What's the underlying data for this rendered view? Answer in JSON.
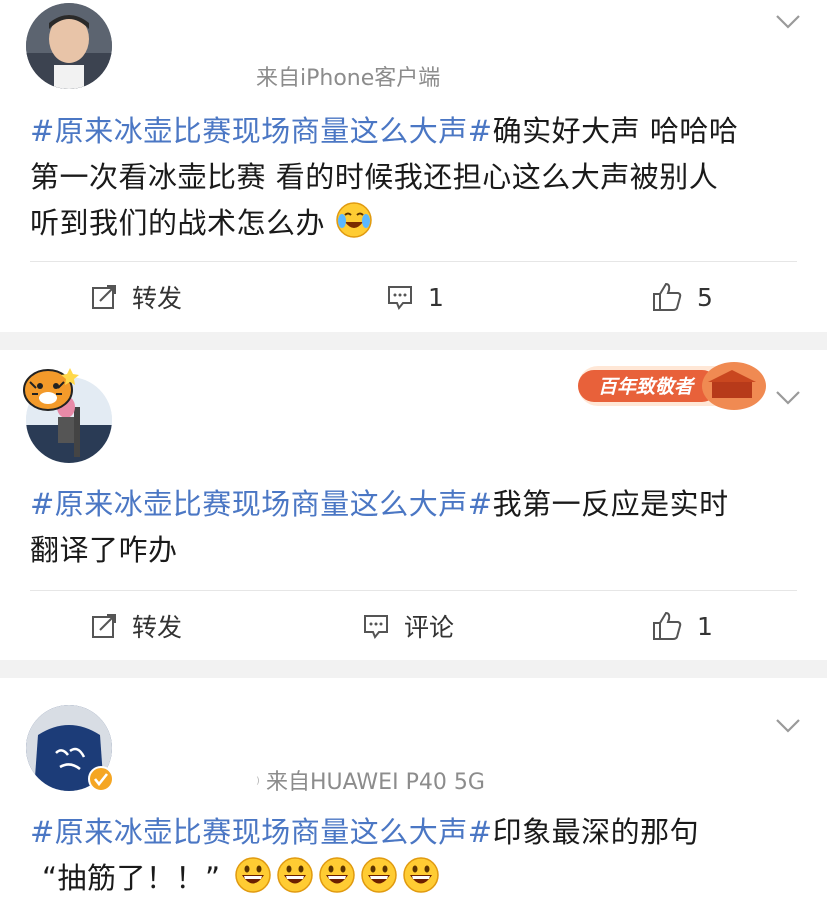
{
  "posts": [
    {
      "source": "来自iPhone客户端",
      "topic": "#原来冰壶比赛现场商量这么大声#",
      "text_line1": "确实好大声 哈哈哈",
      "text_line2": "第一次看冰壶比赛 看的时候我还担心这么大声被别人",
      "text_line3": "听到我们的战术怎么办",
      "emoji": "laugh-cry-emoji",
      "repost_label": "转发",
      "comment_count": "1",
      "like_count": "5"
    },
    {
      "badge_text": "百年致敬者",
      "topic": "#原来冰壶比赛现场商量这么大声#",
      "text_line1": "我第一反应是实时",
      "text_line2": "翻译了咋办",
      "repost_label": "转发",
      "comment_label": "评论",
      "like_count": "1"
    },
    {
      "source_mark": "⁾",
      "source": "来自HUAWEI P40 5G",
      "topic": "#原来冰壶比赛现场商量这么大声#",
      "text_line1": "印象最深的那句",
      "text_line2": "“抽筋了！！”",
      "emoji": "grin-emoji"
    }
  ],
  "colors": {
    "topic": "#4b77c4",
    "badge": "#e8613a",
    "verified": "#f5a623"
  }
}
